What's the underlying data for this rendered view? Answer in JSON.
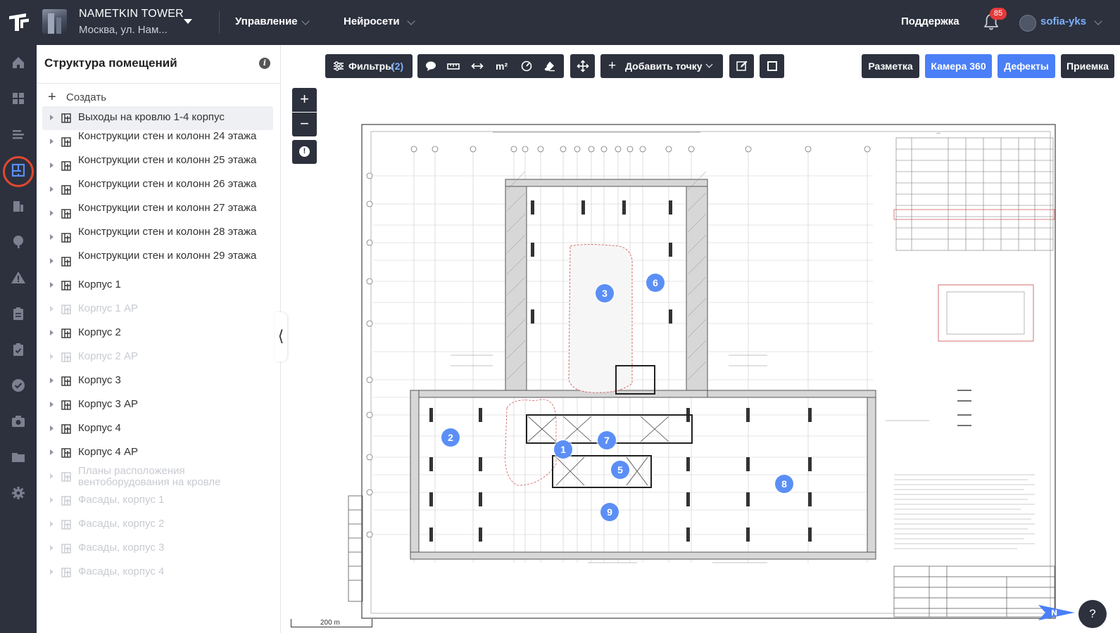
{
  "header": {
    "project_name": "NAMETKIN TOWER",
    "project_address": "Москва, ул. Нам...",
    "menu_manage": "Управление",
    "menu_ai": "Нейросети",
    "support": "Поддержка",
    "notifications_count": "85",
    "username": "sofia-yks"
  },
  "panel": {
    "title": "Структура помещений",
    "info_glyph": "i",
    "create_label": "Создать",
    "items": [
      {
        "label": "Выходы на кровлю 1-4 корпус"
      },
      {
        "label": "Конструкции стен и колонн 24 этажа"
      },
      {
        "label": "Конструкции стен и колонн 25 этажа"
      },
      {
        "label": "Конструкции стен и колонн 26 этажа"
      },
      {
        "label": "Конструкции стен и колонн 27 этажа"
      },
      {
        "label": "Конструкции стен и колонн 28 этажа"
      },
      {
        "label": "Конструкции стен и колонн 29 этажа"
      },
      {
        "label": "Корпус 1"
      },
      {
        "label": "Корпус 1 АР"
      },
      {
        "label": "Корпус 2"
      },
      {
        "label": "Корпус 2 АР"
      },
      {
        "label": "Корпус 3"
      },
      {
        "label": "Корпус 3 АР"
      },
      {
        "label": "Корпус 4"
      },
      {
        "label": "Корпус 4 АР"
      },
      {
        "label": "Планы расположения вентоборудования на кровле"
      },
      {
        "label": "Фасады, корпус 1"
      },
      {
        "label": "Фасады, корпус 2"
      },
      {
        "label": "Фасады, корпус 3"
      },
      {
        "label": "Фасады, корпус 4"
      }
    ]
  },
  "toolbar": {
    "filters_label": "Фильтры",
    "filters_count": "(2)",
    "area_label": "m²",
    "add_point_label": "Добавить точку"
  },
  "modes": {
    "markup": "Разметка",
    "camera360": "Камера 360",
    "defects": "Дефекты",
    "acceptance": "Приемка"
  },
  "zoom": {
    "in": "+",
    "out": "−",
    "alert": "!"
  },
  "markers": [
    {
      "id": "1"
    },
    {
      "id": "2"
    },
    {
      "id": "3"
    },
    {
      "id": "5"
    },
    {
      "id": "6"
    },
    {
      "id": "7"
    },
    {
      "id": "8"
    },
    {
      "id": "9"
    }
  ],
  "map": {
    "scale_label": "200 m",
    "north_label": "N",
    "help_glyph": "?"
  },
  "colors": {
    "dark": "#2c313d",
    "accent": "#4a7ff7",
    "marker": "#5b8ff5",
    "active_ring": "#e2472f",
    "badge": "#e5393b"
  }
}
